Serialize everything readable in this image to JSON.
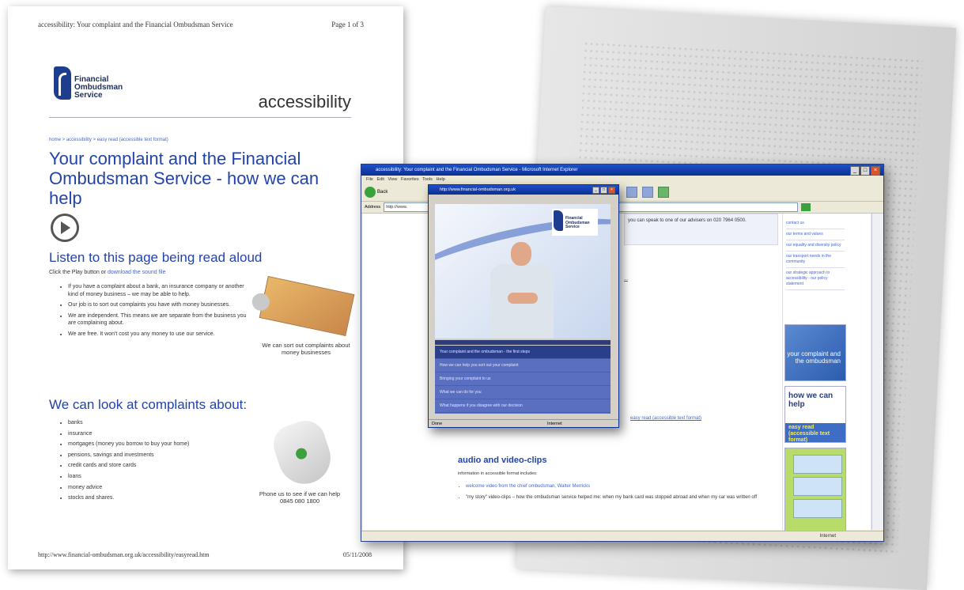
{
  "paper": {
    "header_title": "accessibility: Your complaint and the Financial Ombudsman Service",
    "page_label": "Page 1 of 3",
    "logo_text": "Financial\nOmbudsman\nService",
    "section_word": "accessibility",
    "breadcrumb": "home > accessibility > easy read (accessible text format)",
    "main_heading": "Your complaint and the Financial Ombudsman Service - how we can help",
    "listen_heading": "Listen to this page being read aloud",
    "listen_text": "Click the Play button or",
    "listen_link": "download the sound file",
    "bullets": [
      "If you have a complaint about a bank, an insurance company or another kind of money business – we may be able to help.",
      "Our job is to sort out complaints you have with money businesses.",
      "We are independent. This means we are separate from the business you are complaining about.",
      "We are free. It won't cost you any money to use our service."
    ],
    "caption_money": "We can sort out complaints about money businesses",
    "look_heading": "We can look at complaints about:",
    "complaint_types": [
      "banks",
      "insurance",
      "mortgages (money you borrow to buy your home)",
      "pensions, savings and investments",
      "credit cards and store cards",
      "loans",
      "money advice",
      "stocks and shares."
    ],
    "caption_phone": "Phone us to see if we can help",
    "phone_number": "0845 080 1800",
    "footer_url": "http://www.financial-ombudsman.org.uk/accessibility/easyread.htm",
    "footer_date": "05/11/2008"
  },
  "browser": {
    "title": "accessibility: Your complaint and the Financial Ombudsman Service - Microsoft Internet Explorer",
    "menu": [
      "File",
      "Edit",
      "View",
      "Favorites",
      "Tools",
      "Help"
    ],
    "back_label": "Back",
    "address_label": "Address",
    "address_value": "http://www.",
    "top_box_text": "you can speak to one of our advisers on 020 7964 0500.",
    "av_heading": "audio and video-clips",
    "av_intro": "information in accessible format includes:",
    "av_items": [
      "welcome video from the chief ombudsman, Walter Merricks",
      "\"my story\" video-clips – how the ombudsman service helped me: when my bank card was stopped abroad and when my car was written off"
    ],
    "mid_link": "easy read (accessible text format)",
    "right_links": [
      "contact us",
      "our terms and values",
      "our equality and diversity policy",
      "our transport needs in the community",
      "our strategic approach to accessibility - our policy statement"
    ],
    "promo1": "your complaint and the ombudsman",
    "promo2_how": "how we can help",
    "promo2_easy": "easy read (accessible text format)",
    "status_zone": "Internet"
  },
  "player": {
    "title": "http://www.financial-ombudsman.org.uk",
    "logo_text": "Financial\nOmbudsman\nService",
    "playlist": [
      "Your complaint and the ombudsman - the first steps",
      "How we can help you sort out your complaint",
      "Bringing your complaint to us",
      "What we can do for you",
      "What happens if you disagree with our decision"
    ],
    "status_done": "Done",
    "status_zone": "Internet"
  }
}
